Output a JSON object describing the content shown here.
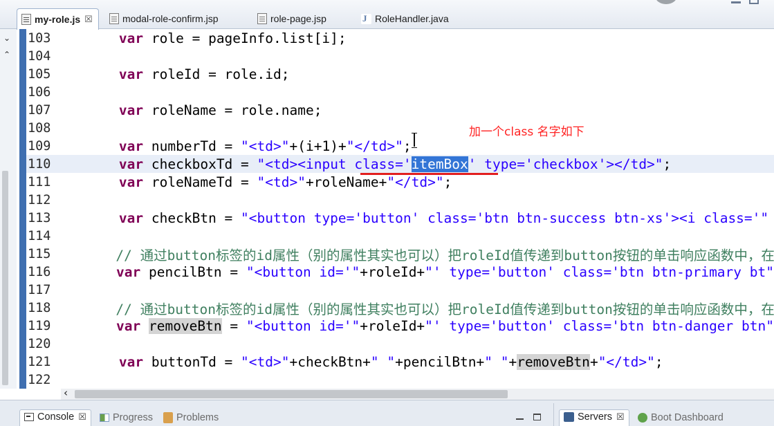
{
  "tabs": [
    {
      "label": "my-role.js",
      "icon": "js-file-icon",
      "active": true,
      "close": "☒"
    },
    {
      "label": "modal-role-confirm.jsp",
      "icon": "jsp-file-icon",
      "active": false
    },
    {
      "label": "role-page.jsp",
      "icon": "jsp-file-icon",
      "active": false
    },
    {
      "label": "RoleHandler.java",
      "icon": "java-file-icon",
      "active": false
    }
  ],
  "editor": {
    "current_line": "110",
    "lines": [
      {
        "n": "103",
        "code": "        var role = pageInfo.list[i];"
      },
      {
        "n": "104",
        "code": ""
      },
      {
        "n": "105",
        "code": "        var roleId = role.id;"
      },
      {
        "n": "106",
        "code": ""
      },
      {
        "n": "107",
        "code": "        var roleName = role.name;"
      },
      {
        "n": "108",
        "code": ""
      },
      {
        "n": "109",
        "code": "        var numberTd = \"<td>\"+(i+1)+\"</td>\";"
      },
      {
        "n": "110",
        "code": "        var checkboxTd = \"<td><input class='itemBox' type='checkbox'></td>\";"
      },
      {
        "n": "111",
        "code": "        var roleNameTd = \"<td>\"+roleName+\"</td>\";"
      },
      {
        "n": "112",
        "code": ""
      },
      {
        "n": "113",
        "code": "        var checkBtn = \"<button type='button' class='btn btn-success btn-xs'><i class='"
      },
      {
        "n": "114",
        "code": ""
      },
      {
        "n": "115",
        "code": "        // 通过button标签的id属性（别的属性其实也可以）把roleId值传递到button按钮的单击响应函数中，在单击响"
      },
      {
        "n": "116",
        "code": "        var pencilBtn = \"<button id='\"+roleId+\"' type='button' class='btn btn-primary bt"
      },
      {
        "n": "117",
        "code": ""
      },
      {
        "n": "118",
        "code": "        // 通过button标签的id属性（别的属性其实也可以）把roleId值传递到button按钮的单击响应函数中，在单击响"
      },
      {
        "n": "119",
        "code": "        var removeBtn = \"<button id='\"+roleId+\"' type='button' class='btn btn-danger btn"
      },
      {
        "n": "120",
        "code": ""
      },
      {
        "n": "121",
        "code": "        var buttonTd = \"<td>\"+checkBtn+\" \"+pencilBtn+\" \"+removeBtn+\"</td>\";"
      },
      {
        "n": "122",
        "code": ""
      }
    ],
    "annotation": "加一个class 名字如下",
    "selected_word": "itemBox",
    "occurrence_word": "removeBtn"
  },
  "bottom_panel": {
    "left_tabs": [
      {
        "label": "Console",
        "icon": "console-icon",
        "active": true,
        "close": "☒"
      },
      {
        "label": "Progress",
        "icon": "progress-icon",
        "active": false
      },
      {
        "label": "Problems",
        "icon": "problems-icon",
        "active": false
      }
    ],
    "right_tabs": [
      {
        "label": "Servers",
        "icon": "servers-icon",
        "active": true,
        "close": "☒"
      },
      {
        "label": "Boot Dashboard",
        "icon": "boot-dashboard-icon",
        "active": false
      }
    ]
  },
  "colors": {
    "keyword": "#7f0055",
    "string": "#2a00ff",
    "comment": "#3f7f5f",
    "selection": "#3375d6",
    "annotation": "#ff2424",
    "marker_bar": "#3f6fb0"
  }
}
